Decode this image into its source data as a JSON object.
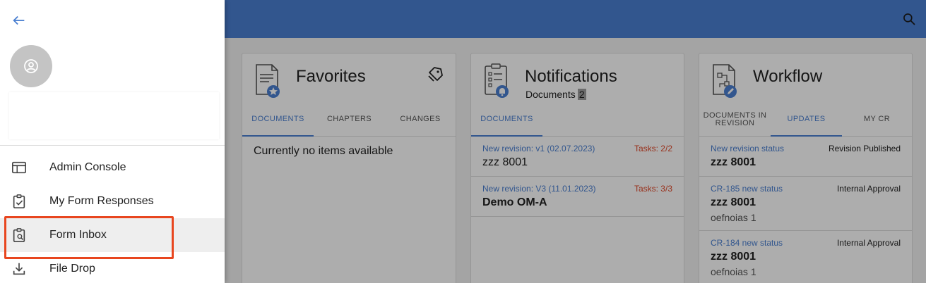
{
  "colors": {
    "topbar": "#4a7fd1",
    "accent": "#4a7fd1",
    "tasks": "#e0492a",
    "highlight": "#e8461f"
  },
  "topbar": {
    "search_icon": "search-icon"
  },
  "cards": {
    "favorites": {
      "title": "Favorites",
      "icon": "document-star-icon",
      "action_icon": "tag-settings-icon",
      "tabs": [
        "DOCUMENTS",
        "CHAPTERS",
        "CHANGES"
      ],
      "active_tab": 0,
      "empty_text": "Currently no items available"
    },
    "notifications": {
      "title": "Notifications",
      "subtitle": "Documents",
      "badge": "2",
      "icon": "checklist-bell-icon",
      "tabs": [
        "DOCUMENTS"
      ],
      "active_tab": 0,
      "items": [
        {
          "link": "New revision: v1 (02.07.2023)",
          "tasks": "Tasks: 2/2",
          "title": "zzz 8001"
        },
        {
          "link": "New revision: V3 (11.01.2023)",
          "tasks": "Tasks: 3/3",
          "title": "Demo OM-A"
        }
      ]
    },
    "workflow": {
      "title": "Workflow",
      "icon": "workflow-document-icon",
      "tabs": [
        "DOCUMENTS IN REVISION",
        "UPDATES",
        "MY CR"
      ],
      "active_tab": 1,
      "items": [
        {
          "link": "New revision status",
          "status": "Revision Published",
          "title": "zzz 8001",
          "extra": ""
        },
        {
          "link": "CR-185 new status",
          "status": "Internal Approval",
          "title": "zzz 8001",
          "extra": "oefnoias 1"
        },
        {
          "link": "CR-184 new status",
          "status": "Internal Approval",
          "title": "zzz 8001",
          "extra": "oefnoias 1"
        }
      ]
    }
  },
  "drawer": {
    "back_icon": "arrow-left-icon",
    "avatar_icon": "user-circle-icon",
    "menu": [
      {
        "label": "Admin Console",
        "icon": "browser-window-icon"
      },
      {
        "label": "My Form Responses",
        "icon": "clipboard-check-icon"
      },
      {
        "label": "Form Inbox",
        "icon": "clipboard-search-icon",
        "selected": true
      },
      {
        "label": "File Drop",
        "icon": "download-icon"
      }
    ]
  }
}
